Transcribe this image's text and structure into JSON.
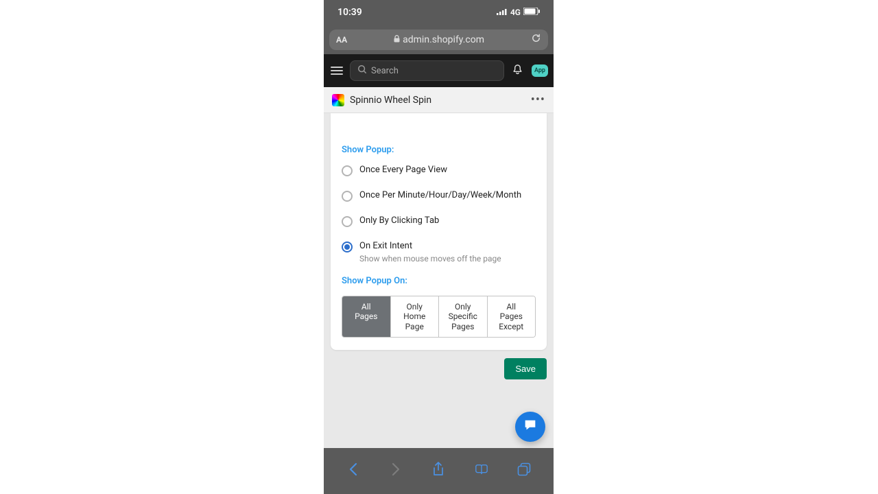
{
  "ios": {
    "time": "10:39",
    "network_type": "4G"
  },
  "safari": {
    "aa_label": "AA",
    "url": "admin.shopify.com"
  },
  "admin": {
    "search_placeholder": "Search",
    "app_badge_label": "App"
  },
  "app": {
    "title": "Spinnio Wheel Spin",
    "more_label": "•••"
  },
  "settings": {
    "show_popup_label": "Show Popup:",
    "radios": [
      {
        "label": "Once Every Page View",
        "selected": false
      },
      {
        "label": "Once Per Minute/Hour/Day/Week/Month",
        "selected": false
      },
      {
        "label": "Only By Clicking Tab",
        "selected": false
      },
      {
        "label": "On Exit Intent",
        "selected": true,
        "desc": "Show when mouse moves off the page"
      }
    ],
    "show_popup_on_label": "Show Popup On:",
    "segments": [
      {
        "label": "All\nPages",
        "active": true
      },
      {
        "label": "Only\nHome\nPage",
        "active": false
      },
      {
        "label": "Only\nSpecific\nPages",
        "active": false
      },
      {
        "label": "All\nPages\nExcept",
        "active": false
      }
    ],
    "save_label": "Save"
  }
}
